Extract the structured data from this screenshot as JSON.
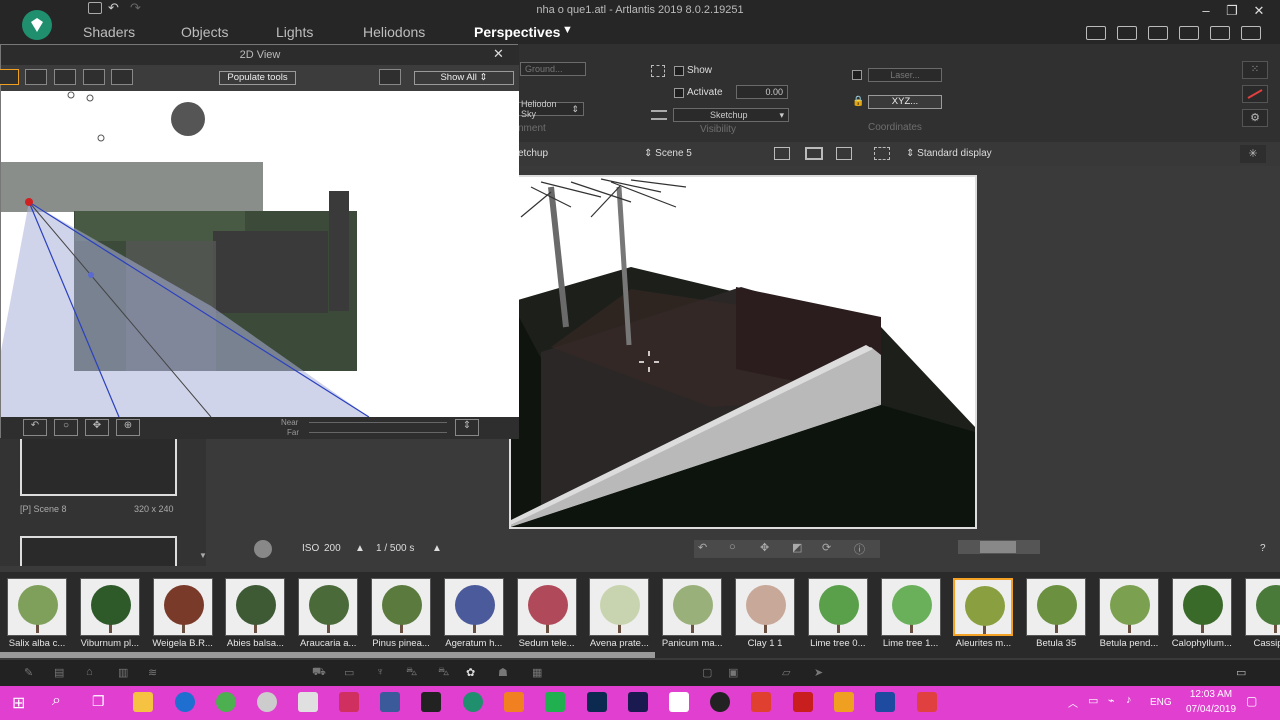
{
  "app": {
    "title": "nha o que1.atl - Artlantis 2019 8.0.2.19251"
  },
  "main_tabs": [
    {
      "label": "Shaders"
    },
    {
      "label": "Objects"
    },
    {
      "label": "Lights"
    },
    {
      "label": "Heliodons"
    },
    {
      "label": "Perspectives"
    }
  ],
  "panel": {
    "ground_placeholder": "Ground...",
    "heliodon_sky": "Heliodon Sky",
    "environment_label": "nment",
    "show_label": "Show",
    "activate_label": "Activate",
    "activate_value": "0.00",
    "sketchup_select": "Sketchup",
    "visibility_label": "Visibility",
    "laser_placeholder": "Laser...",
    "xyz_button": "XYZ...",
    "coordinates_label": "Coordinates"
  },
  "viewbar": {
    "source": "etchup",
    "scene": "Scene 5",
    "display": "Standard display"
  },
  "two_d": {
    "title": "2D View",
    "populate": "Populate tools",
    "show_all": "Show All",
    "near": "Near",
    "far": "Far"
  },
  "left_list": {
    "item_name": "[P] Scene 8",
    "item_size": "320 x 240"
  },
  "camera": {
    "iso_label": "ISO",
    "iso_value": "200",
    "shutter": "1 / 500 s"
  },
  "library": [
    {
      "label": "Salix alba c...",
      "color": "#7fa05a"
    },
    {
      "label": "Viburnum pl...",
      "color": "#2e5a2a"
    },
    {
      "label": "Weigela B.R...",
      "color": "#7a3a2a"
    },
    {
      "label": "Abies balsa...",
      "color": "#3d5a35"
    },
    {
      "label": "Araucaria a...",
      "color": "#4a6a3a"
    },
    {
      "label": "Pinus pinea...",
      "color": "#5a7a3e"
    },
    {
      "label": "Ageratum h...",
      "color": "#4a5a9a"
    },
    {
      "label": "Sedum tele...",
      "color": "#b04a5a"
    },
    {
      "label": "Avena prate...",
      "color": "#c8d4b0"
    },
    {
      "label": "Panicum ma...",
      "color": "#9ab07a"
    },
    {
      "label": "Clay 1 1",
      "color": "#c8a898"
    },
    {
      "label": "Lime tree 0...",
      "color": "#5aa04a"
    },
    {
      "label": "Lime tree 1...",
      "color": "#6ab05a"
    },
    {
      "label": "Aleurites m...",
      "color": "#8aa040"
    },
    {
      "label": "Betula 35",
      "color": "#6a9040"
    },
    {
      "label": "Betula pend...",
      "color": "#7aa050"
    },
    {
      "label": "Calophyllum...",
      "color": "#3a6a2a"
    },
    {
      "label": "Cassipo...",
      "color": "#4a7a3a"
    }
  ],
  "clock": {
    "time": "12:03 AM",
    "date": "07/04/2019",
    "lang": "ENG"
  }
}
